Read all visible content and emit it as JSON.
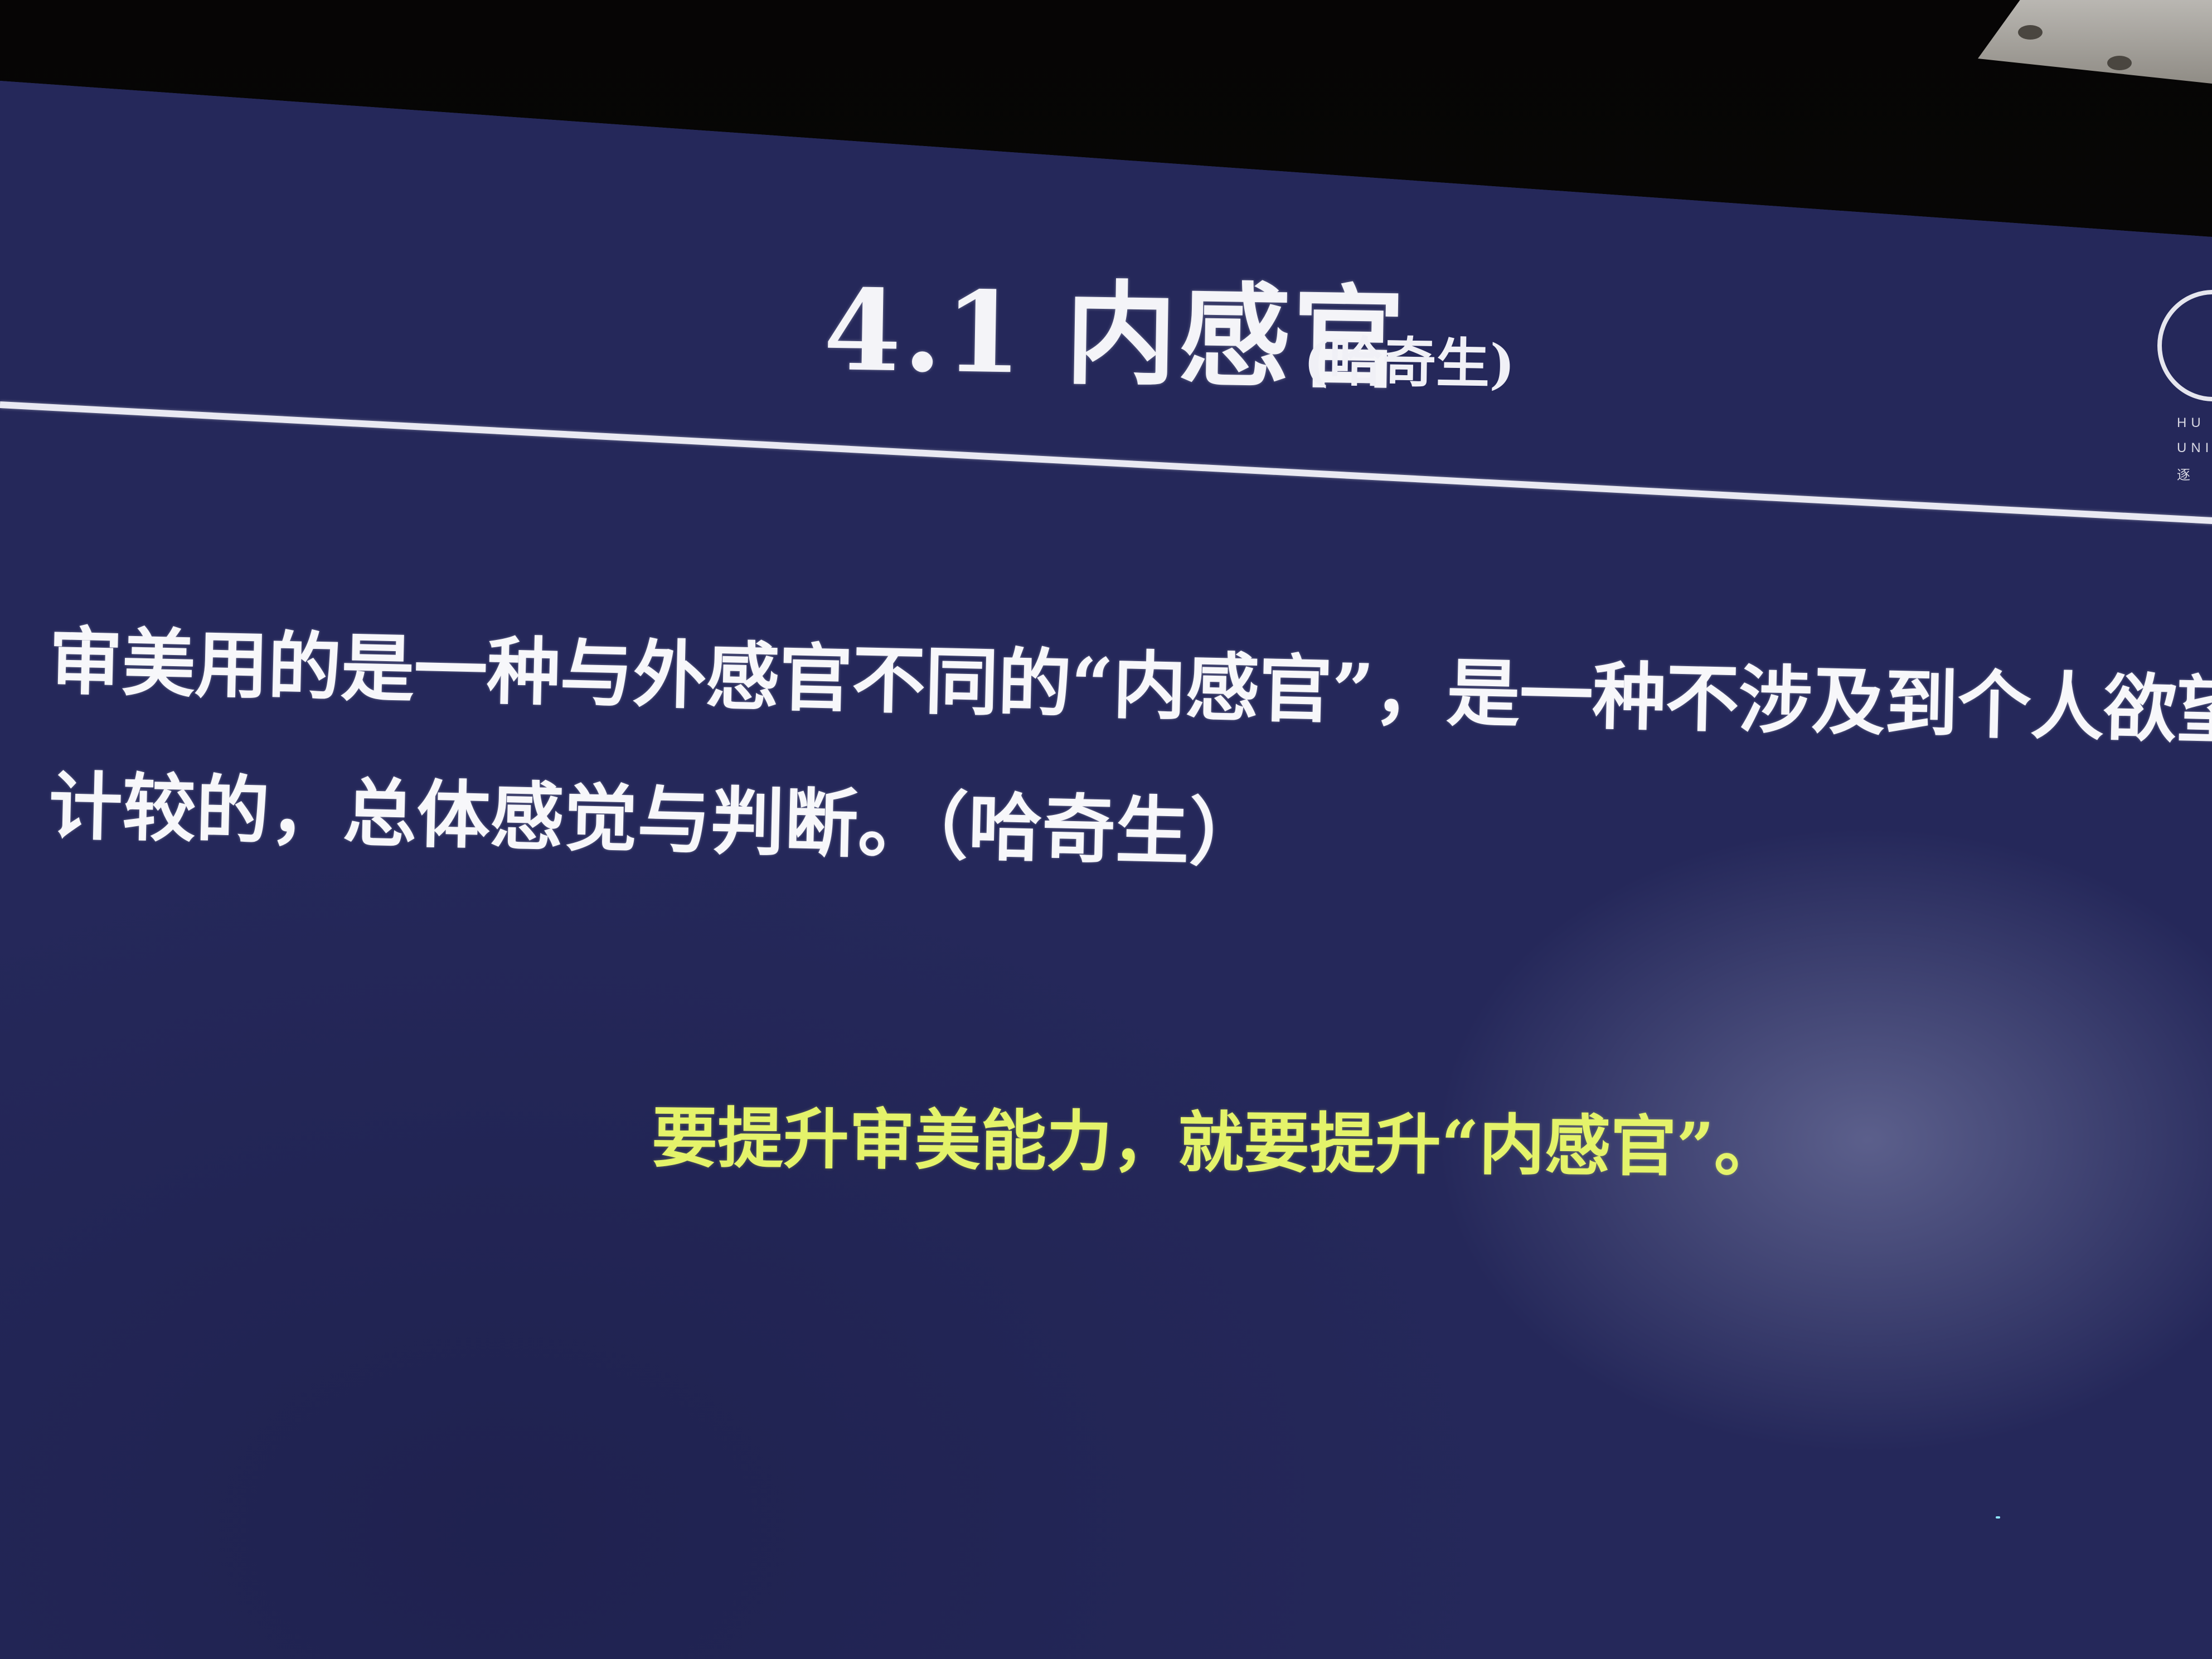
{
  "slide": {
    "title": "4.1 内感官",
    "title_note": "(哈奇生)",
    "body_line_1": "审美用的是一种与外感官不同的“内感官”，是一种不涉及到个人欲望和利害",
    "body_line_2": "计较的，总体感觉与判断。（哈奇生）",
    "highlight": "要提升审美能力，就要提升“内感官”。",
    "logo_text_1": "HU",
    "logo_text_2": "UNIV",
    "logo_text_3": "逐"
  },
  "colors": {
    "screen_background": "#25285a",
    "text": "#f7f7fa",
    "highlight_text": "#e4f36a",
    "rule": "#e9e9f2"
  }
}
